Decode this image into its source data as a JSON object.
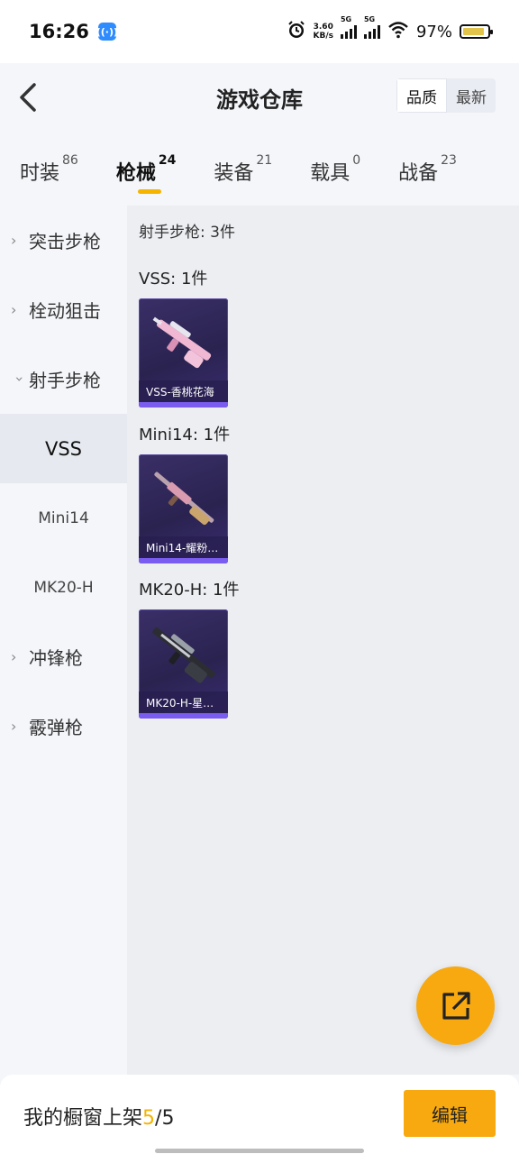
{
  "status_bar": {
    "time": "16:26",
    "speed_value": "3.60",
    "speed_unit": "KB/s",
    "net1": "5G",
    "net2": "5G",
    "battery": "97%"
  },
  "header": {
    "title": "游戏仓库",
    "sort_options": [
      "品质",
      "最新"
    ],
    "active_sort": "品质"
  },
  "tabs": [
    {
      "label": "时装",
      "count": "86"
    },
    {
      "label": "枪械",
      "count": "24"
    },
    {
      "label": "装备",
      "count": "21"
    },
    {
      "label": "载具",
      "count": "0"
    },
    {
      "label": "战备",
      "count": "23"
    }
  ],
  "active_tab": "枪械",
  "sidebar": {
    "categories": [
      {
        "label": "突击步枪",
        "expanded": false
      },
      {
        "label": "栓动狙击",
        "expanded": false
      },
      {
        "label": "射手步枪",
        "expanded": true
      }
    ],
    "subitems": [
      {
        "label": "VSS",
        "active": true
      },
      {
        "label": "Mini14",
        "active": false
      },
      {
        "label": "MK20-H",
        "active": false
      }
    ],
    "more_categories": [
      {
        "label": "冲锋枪",
        "expanded": false
      },
      {
        "label": "霰弹枪",
        "expanded": false
      }
    ]
  },
  "content": {
    "section_title": "射手步枪: 3件",
    "groups": [
      {
        "title": "VSS: 1件",
        "item_label": "VSS-香桃花海",
        "skin_color": "#e9a9c8"
      },
      {
        "title": "Mini14: 1件",
        "item_label": "Mini14-耀粉…",
        "skin_color": "#c98a9e"
      },
      {
        "title": "MK20-H: 1件",
        "item_label": "MK20-H-星…",
        "skin_color": "#8b8f96"
      }
    ]
  },
  "bottom_bar": {
    "shelf_prefix": "我的橱窗上架",
    "shelf_current": "5",
    "shelf_sep": "/",
    "shelf_total": "5",
    "edit_label": "编辑"
  },
  "colors": {
    "accent": "#f7a90f",
    "card_bg": "#2a2350",
    "card_bar": "#7b5cf0"
  }
}
